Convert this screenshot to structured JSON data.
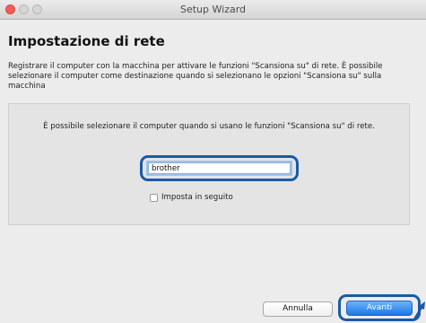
{
  "window": {
    "title": "Setup Wizard"
  },
  "page": {
    "heading": "Impostazione di rete",
    "description": "Registrare il computer con la macchina per attivare le funzioni \"Scansiona su\" di rete. È possibile selezionare il computer come destinazione quando si selezionano le opzioni \"Scansiona su\" sulla macchina"
  },
  "panel": {
    "text": "È possibile selezionare il computer quando si usano le funzioni \"Scansiona su\" di rete.",
    "input_value": "brother",
    "checkbox_label": "Imposta in seguito",
    "checkbox_checked": false
  },
  "buttons": {
    "cancel_label": "Annulla",
    "next_label": "Avanti"
  },
  "colors": {
    "highlight": "#1a5aa6",
    "primary_button": "#1c78e8",
    "close_button": "#f15f56"
  }
}
